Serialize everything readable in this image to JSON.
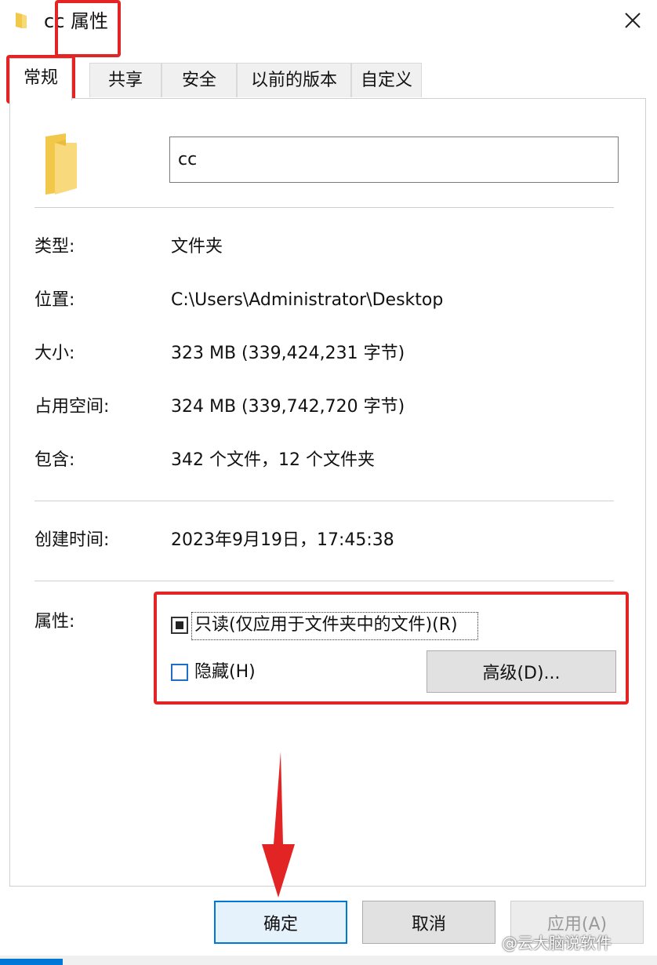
{
  "window": {
    "title": "cc 属性",
    "close_icon": "close-icon"
  },
  "tabs": [
    {
      "label": "常规",
      "active": true
    },
    {
      "label": "共享"
    },
    {
      "label": "安全"
    },
    {
      "label": "以前的版本"
    },
    {
      "label": "自定义"
    }
  ],
  "general": {
    "folder_name": "cc",
    "rows": [
      {
        "label": "类型:",
        "value": "文件夹"
      },
      {
        "label": "位置:",
        "value": "C:\\Users\\Administrator\\Desktop"
      },
      {
        "label": "大小:",
        "value": "323 MB (339,424,231 字节)"
      },
      {
        "label": "占用空间:",
        "value": "324 MB (339,742,720 字节)"
      },
      {
        "label": "包含:",
        "value": "342 个文件，12 个文件夹"
      }
    ],
    "created": {
      "label": "创建时间:",
      "value": "2023年9月19日，17:45:38"
    },
    "attributes": {
      "label": "属性:",
      "readonly_label": "只读(仅应用于文件夹中的文件)(R)",
      "readonly_state": "indeterminate",
      "hidden_label": "隐藏(H)",
      "hidden_checked": false,
      "advanced_button": "高级(D)..."
    }
  },
  "buttons": {
    "ok": "确定",
    "cancel": "取消",
    "apply": "应用(A)"
  },
  "watermark": "@云大脑说软件",
  "colors": {
    "highlight_red": "#e32424",
    "accent_blue": "#0078d7",
    "folder_yellow": "#f6cf5b"
  }
}
